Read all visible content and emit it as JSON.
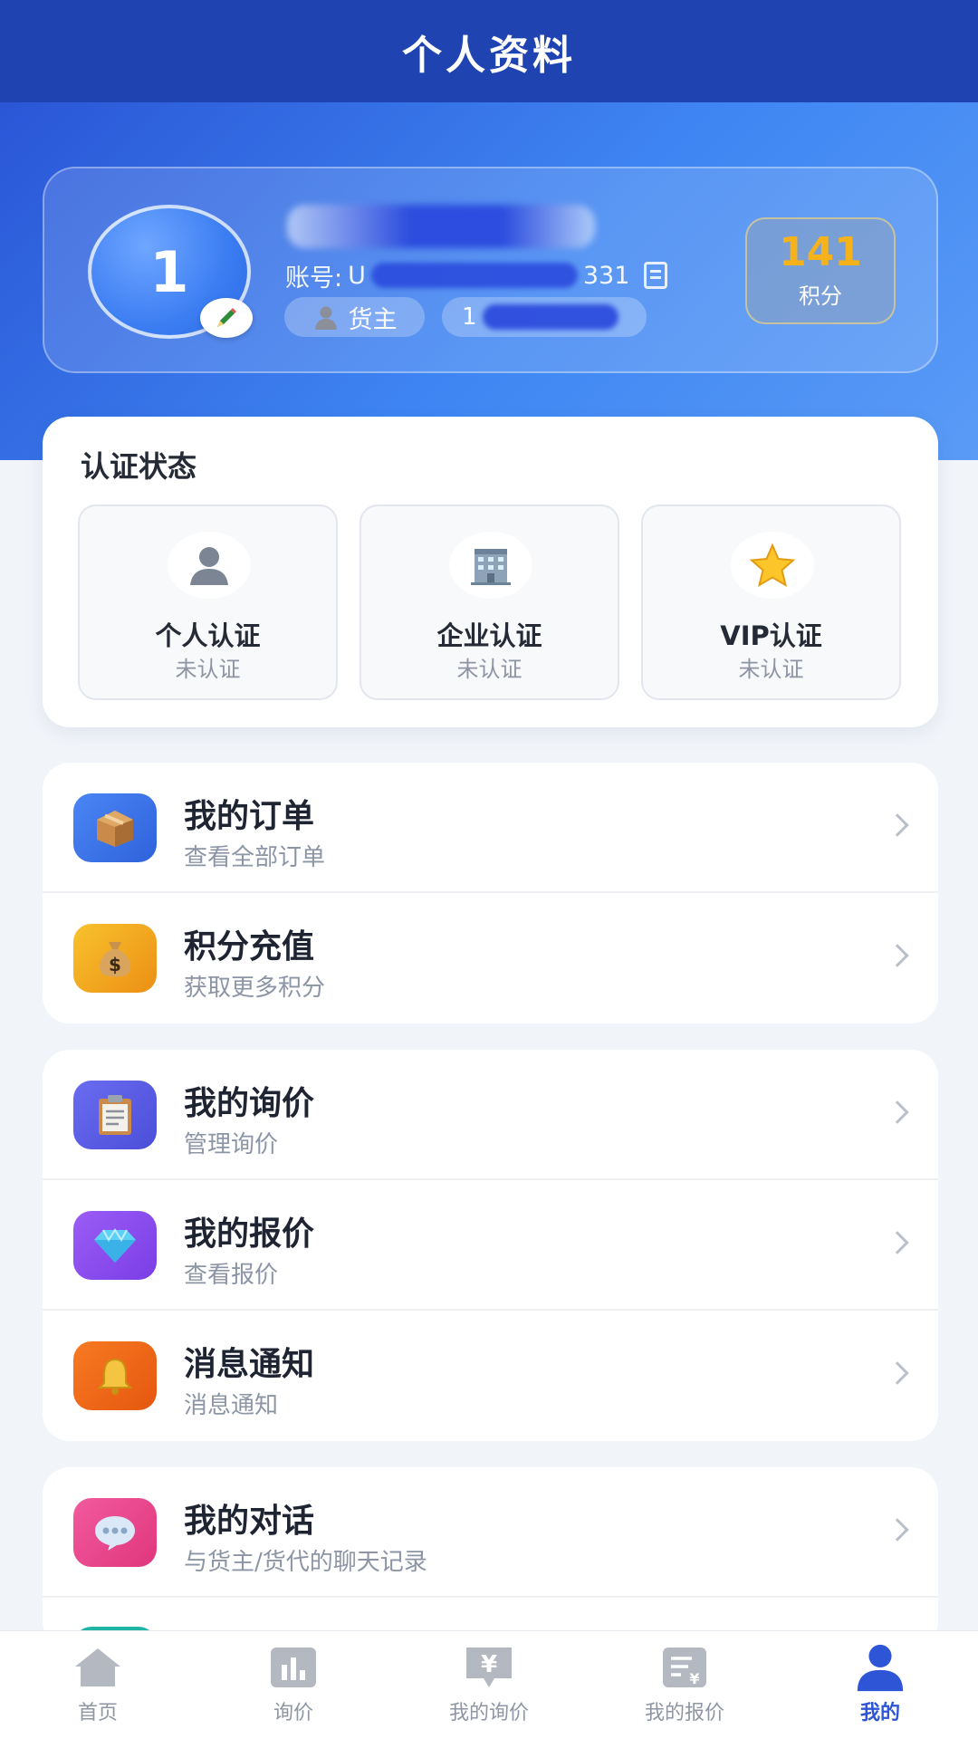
{
  "header": {
    "title": "个人资料"
  },
  "profile": {
    "avatar_text": "1",
    "account_label": "账号:",
    "account_visible_prefix": "U",
    "account_visible_suffix": "331",
    "role": "货主",
    "phone_visible_prefix": "1",
    "points_value": "141",
    "points_label": "积分"
  },
  "certification": {
    "title": "认证状态",
    "items": [
      {
        "name": "个人认证",
        "status": "未认证",
        "icon": "person-icon"
      },
      {
        "name": "企业认证",
        "status": "未认证",
        "icon": "building-icon"
      },
      {
        "name": "VIP认证",
        "status": "未认证",
        "icon": "star-icon"
      }
    ]
  },
  "menu_groups": [
    [
      {
        "title": "我的订单",
        "subtitle": "查看全部订单",
        "icon": "package-icon",
        "color": "#3b6fe8"
      },
      {
        "title": "积分充值",
        "subtitle": "获取更多积分",
        "icon": "money-bag-icon",
        "color": "#f0a21a"
      }
    ],
    [
      {
        "title": "我的询价",
        "subtitle": "管理询价",
        "icon": "clipboard-icon",
        "color": "#5b5ee8"
      },
      {
        "title": "我的报价",
        "subtitle": "查看报价",
        "icon": "diamond-icon",
        "color": "#8a4ef0"
      },
      {
        "title": "消息通知",
        "subtitle": "消息通知",
        "icon": "bell-icon",
        "color": "#f0681a"
      }
    ],
    [
      {
        "title": "我的对话",
        "subtitle": "与货主/货代的聊天记录",
        "icon": "chat-icon",
        "color": "#ec4a90"
      }
    ]
  ],
  "tabbar": {
    "items": [
      {
        "label": "首页",
        "icon": "home-icon"
      },
      {
        "label": "询价",
        "icon": "chart-icon"
      },
      {
        "label": "我的询价",
        "icon": "inquiry-icon"
      },
      {
        "label": "我的报价",
        "icon": "quote-icon"
      },
      {
        "label": "我的",
        "icon": "profile-icon"
      }
    ],
    "active_index": 4
  }
}
